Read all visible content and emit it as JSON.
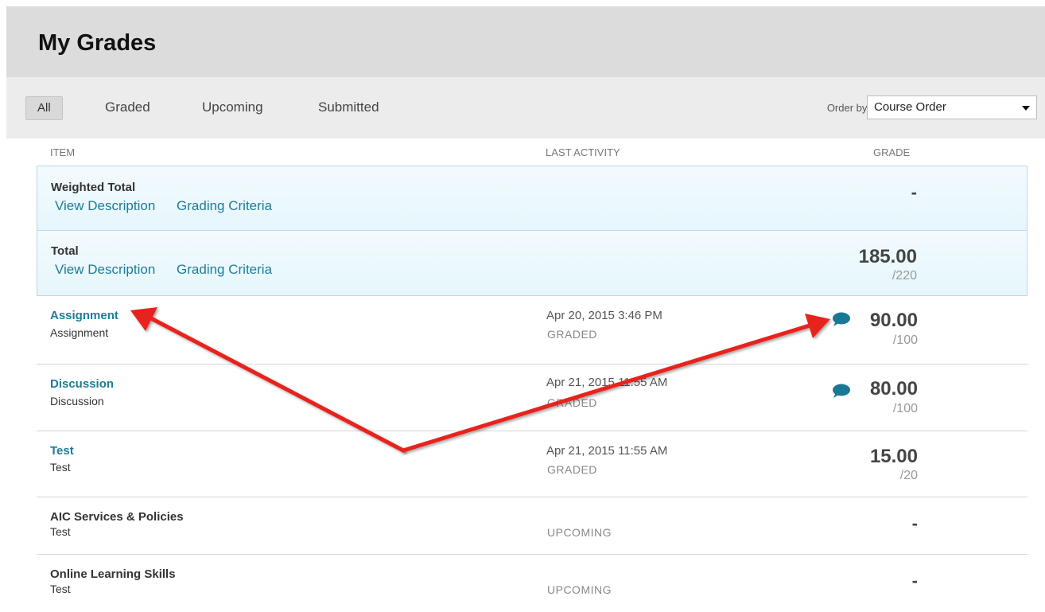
{
  "page": {
    "title": "My Grades"
  },
  "filters": {
    "tabs": [
      "All",
      "Graded",
      "Upcoming",
      "Submitted"
    ],
    "active": "All",
    "order_label": "Order by:",
    "order_value": "Course Order"
  },
  "columns": {
    "item": "ITEM",
    "activity": "LAST ACTIVITY",
    "grade": "GRADE"
  },
  "rows": [
    {
      "title": "Weighted Total",
      "links": [
        "View Description",
        "Grading Criteria"
      ],
      "grade": "-"
    },
    {
      "title": "Total",
      "links": [
        "View Description",
        "Grading Criteria"
      ],
      "grade": "185.00",
      "out_of": "/220"
    },
    {
      "title": "Assignment",
      "subtitle": "Assignment",
      "date": "Apr 20, 2015 3:46 PM",
      "status": "GRADED",
      "grade": "90.00",
      "out_of": "/100",
      "feedback_icon": "comment-bubble-icon"
    },
    {
      "title": "Discussion",
      "subtitle": "Discussion",
      "date": "Apr 21, 2015 11:55 AM",
      "status": "GRADED",
      "grade": "80.00",
      "out_of": "/100",
      "feedback_icon": "comment-bubble-icon"
    },
    {
      "title": "Test",
      "subtitle": "Test",
      "date": "Apr 21, 2015 11:55 AM",
      "status": "GRADED",
      "grade": "15.00",
      "out_of": "/20"
    },
    {
      "title": "AIC Services & Policies",
      "subtitle": "Test",
      "status": "UPCOMING",
      "grade": "-"
    },
    {
      "title": "Online Learning Skills",
      "subtitle": "Test",
      "status": "UPCOMING",
      "grade": "-"
    }
  ],
  "colors": {
    "link": "#1d7c96",
    "annotation_arrow": "#e8231b",
    "bubble": "#1a7896"
  }
}
